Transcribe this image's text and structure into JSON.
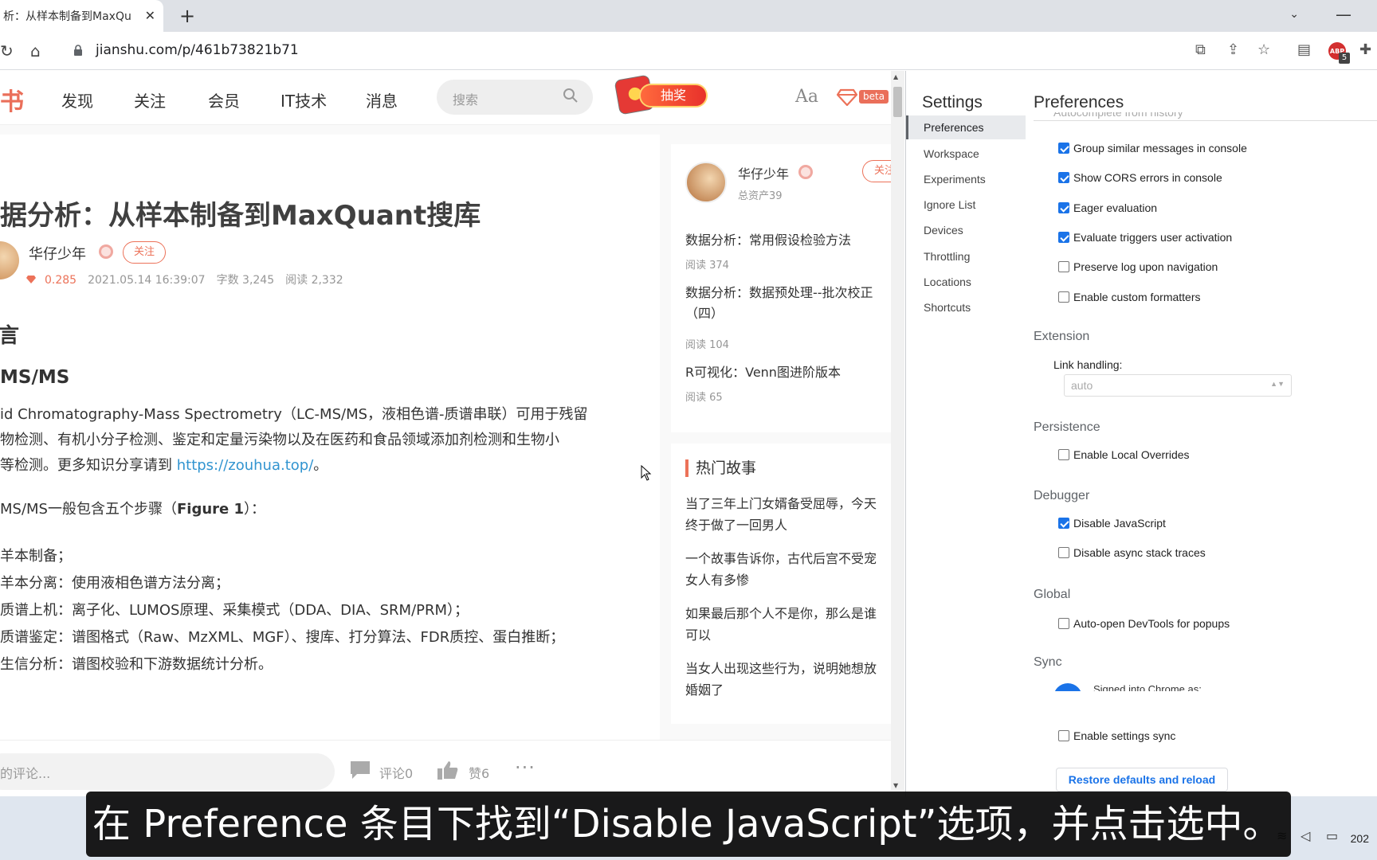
{
  "browser": {
    "tab_title": "析：从样本制备到MaxQu",
    "tab_close": "✕",
    "new_tab": "+",
    "url": "jianshu.com/p/461b73821b71"
  },
  "jianshu": {
    "logo_fragment": "书",
    "nav": [
      "发现",
      "关注",
      "会员",
      "IT技术",
      "消息"
    ],
    "search_placeholder": "搜索",
    "lottery_label": "抽奖",
    "font_toggle": "Aa",
    "beta_label": "beta",
    "article": {
      "title": "据分析：从样本制备到MaxQuant搜库",
      "author": "华仔少年",
      "follow": "关注",
      "diamonds": "0.285",
      "date": "2021.05.14 16:39:07",
      "word_count": "字数 3,245",
      "reads": "阅读 2,332",
      "heading1": "言",
      "heading2": "MS/MS",
      "p1_line1": "id Chromatography-Mass Spectrometry（LC-MS/MS，液相色谱-质谱串联）可用于残留",
      "p1_line2": "物检测、有机小分子检测、鉴定和定量污染物以及在医药和食品领域添加剂检测和生物小",
      "p1_line3_pre": "等检测。更多知识分享请到 ",
      "p1_link": "https://zouhua.top/",
      "p1_line3_post": "。",
      "p2_pre": "MS/MS一般包含五个步骤（",
      "p2_bold": "Figure 1",
      "p2_post": "）：",
      "steps": [
        "羊本制备；",
        "羊本分离：使用液相色谱方法分离；",
        "质谱上机：离子化、LUMOS原理、采集模式（DDA、DIA、SRM/PRM）；",
        "质谱鉴定：谱图格式（Raw、MzXML、MGF）、搜库、打分算法、FDR质控、蛋白推断；",
        "生信分析：谱图校验和下游数据统计分析。"
      ]
    },
    "sidebar": {
      "author": "华仔少年",
      "assets": "总资产39",
      "follow": "关注",
      "articles": [
        {
          "title": "数据分析：常用假设检验方法",
          "reads": "阅读 374"
        },
        {
          "title": "数据分析：数据预处理--批次校正",
          "title2": "（四）",
          "reads": "阅读 104"
        },
        {
          "title": "R可视化：Venn图进阶版本",
          "reads": "阅读 65"
        }
      ]
    },
    "hot": {
      "title": "热门故事",
      "items": [
        [
          "当了三年上门女婿备受屈辱，今天",
          "终于做了一回男人"
        ],
        [
          "一个故事告诉你，古代后宫不受宠",
          "女人有多惨"
        ],
        [
          "如果最后那个人不是你，那么是谁",
          "可以"
        ],
        [
          "当女人出现这些行为，说明她想放",
          "婚姻了"
        ]
      ]
    },
    "bottom": {
      "comment_placeholder": "的评论...",
      "comments": "评论0",
      "likes": "赞6",
      "more": "···"
    }
  },
  "devtools": {
    "settings_title": "Settings",
    "nav": [
      "Preferences",
      "Workspace",
      "Experiments",
      "Ignore List",
      "Devices",
      "Throttling",
      "Locations",
      "Shortcuts"
    ],
    "active_nav": "Preferences",
    "pref_title": "Preferences",
    "cut_option": "Autocomplete from history",
    "console_options": [
      {
        "label": "Group similar messages in console",
        "checked": true
      },
      {
        "label": "Show CORS errors in console",
        "checked": true
      },
      {
        "label": "Eager evaluation",
        "checked": true
      },
      {
        "label": "Evaluate triggers user activation",
        "checked": true
      },
      {
        "label": "Preserve log upon navigation",
        "checked": false
      },
      {
        "label": "Enable custom formatters",
        "checked": false
      }
    ],
    "extension_title": "Extension",
    "link_handling_label": "Link handling:",
    "link_handling_value": "auto",
    "persistence_title": "Persistence",
    "local_overrides": "Enable Local Overrides",
    "debugger_title": "Debugger",
    "disable_js": "Disable JavaScript",
    "disable_async": "Disable async stack traces",
    "global_title": "Global",
    "auto_open": "Auto-open DevTools for popups",
    "sync_title": "Sync",
    "signed_in": "Signed into Chrome as:",
    "settings_sync": "Enable settings sync",
    "restore": "Restore defaults and reload"
  },
  "subtitle": "在 Preference 条目下找到“Disable JavaScript”选项，并点击选中。",
  "tray_clock": "202"
}
